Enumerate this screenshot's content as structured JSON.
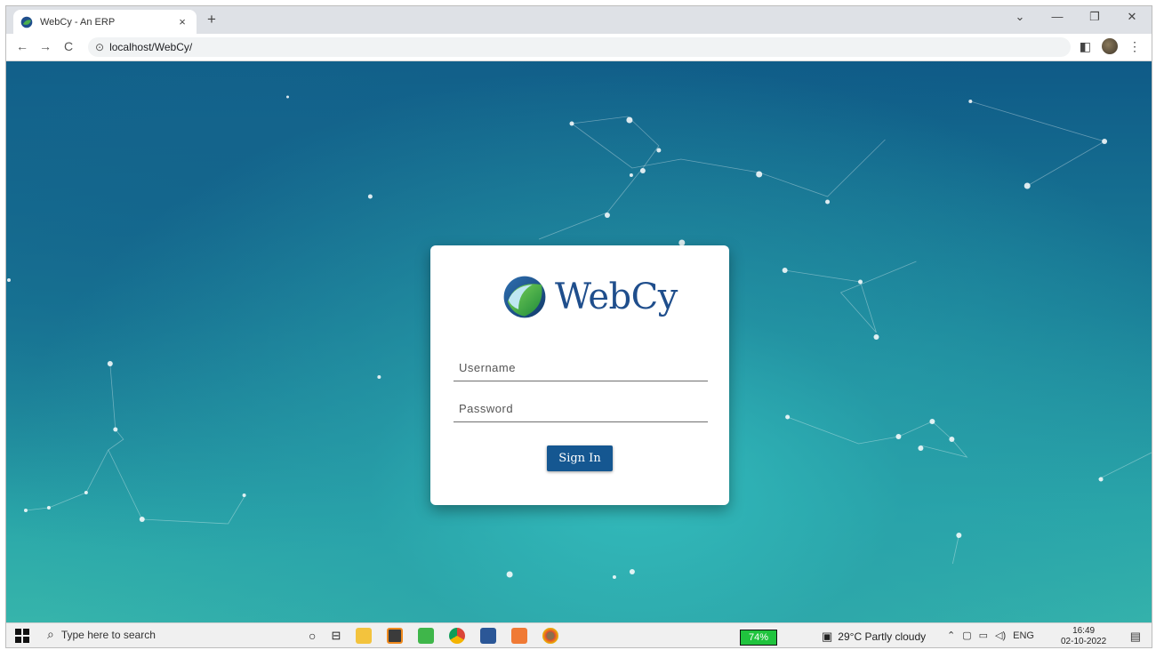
{
  "browser": {
    "tab_title": "WebCy - An ERP",
    "tab_close": "×",
    "new_tab": "+",
    "url": "localhost/WebCy/",
    "back": "←",
    "forward": "→",
    "reload": "C",
    "menu": "⋮",
    "sidepanel": "◧",
    "win_minimize": "—",
    "win_restore": "❐",
    "win_close": "✕",
    "tab_list": "⌄"
  },
  "login": {
    "logo_text": "WebCy",
    "username_placeholder": "Username",
    "password_placeholder": "Password",
    "signin_label": "Sign In"
  },
  "taskbar": {
    "search_placeholder": "Type here to search",
    "battery": "74%",
    "weather": "29°C  Partly cloudy",
    "language": "ENG",
    "time": "16:49",
    "date": "02-10-2022"
  },
  "colors": {
    "accent": "#155791",
    "logo_blue": "#1f4e8c",
    "logo_green": "#3aa33a"
  }
}
